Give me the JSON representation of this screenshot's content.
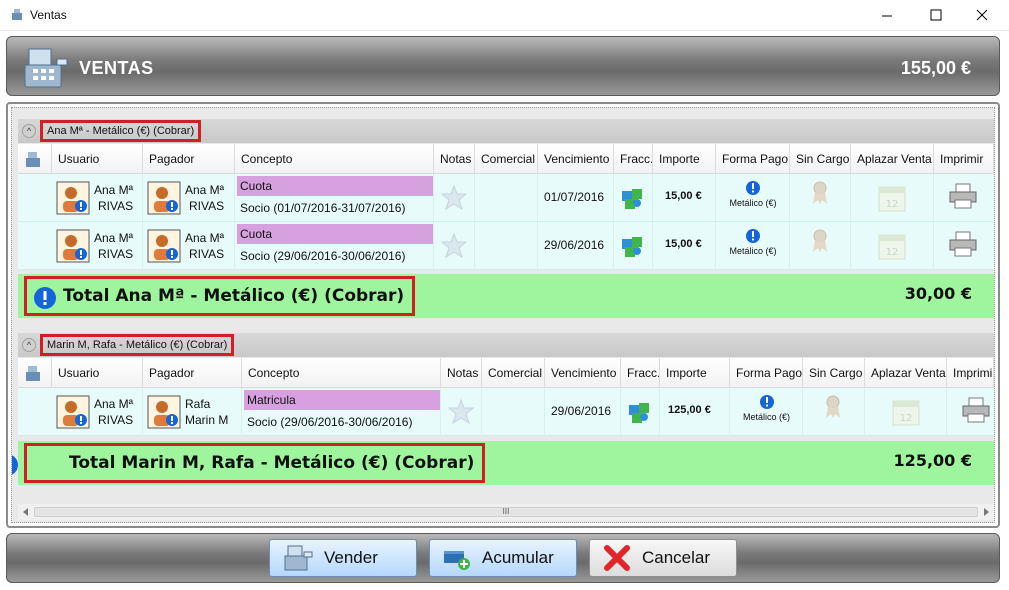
{
  "window": {
    "title": "Ventas"
  },
  "banner": {
    "title": "VENTAS",
    "total": "155,00 €"
  },
  "columns": [
    "Usuario",
    "Pagador",
    "Concepto",
    "Notas",
    "Comercial",
    "Vencimiento",
    "Fracc.",
    "Importe",
    "Forma Pago",
    "Sin Cargo",
    "Aplazar Venta",
    "Imprimir"
  ],
  "groups": [
    {
      "header": "Ana Mª - Metálico (€) (Cobrar)",
      "rows": [
        {
          "usuario": [
            "Ana Mª",
            "RIVAS"
          ],
          "pagador": [
            "Ana Mª",
            "RIVAS"
          ],
          "concepto": "Cuota",
          "detalle": "Socio (01/07/2016-31/07/2016)",
          "vencimiento": "01/07/2016",
          "importe": "15,00 €",
          "forma_pago": "Metálico (€)"
        },
        {
          "usuario": [
            "Ana Mª",
            "RIVAS"
          ],
          "pagador": [
            "Ana Mª",
            "RIVAS"
          ],
          "concepto": "Cuota",
          "detalle": "Socio (29/06/2016-30/06/2016)",
          "vencimiento": "29/06/2016",
          "importe": "15,00 €",
          "forma_pago": "Metálico (€)"
        }
      ],
      "total_label": "Total  Ana Mª - Metálico (€) (Cobrar)",
      "total_amount": "30,00 €"
    },
    {
      "header": "Marin M, Rafa - Metálico (€) (Cobrar)",
      "rows": [
        {
          "usuario": [
            "Ana Mª",
            "RIVAS"
          ],
          "pagador": [
            "Rafa",
            "Marin M"
          ],
          "concepto": "Matricula",
          "detalle": "Socio (29/06/2016-30/06/2016)",
          "vencimiento": "29/06/2016",
          "importe": "125,00 €",
          "forma_pago": "Metálico (€)"
        }
      ],
      "total_label": "Total  Marin M, Rafa - Metálico (€) (Cobrar)",
      "total_amount": "125,00 €"
    }
  ],
  "buttons": {
    "vender": "Vender",
    "acumular": "Acumular",
    "cancelar": "Cancelar"
  },
  "scrollbar": {
    "grip": "III"
  },
  "colors": {
    "concept_tag": "#d7a1e0",
    "total_bar": "#9ff59d",
    "row_bg": "#e8fbfb",
    "highlight_border": "#d21f25",
    "info_blue": "#1565d8"
  }
}
